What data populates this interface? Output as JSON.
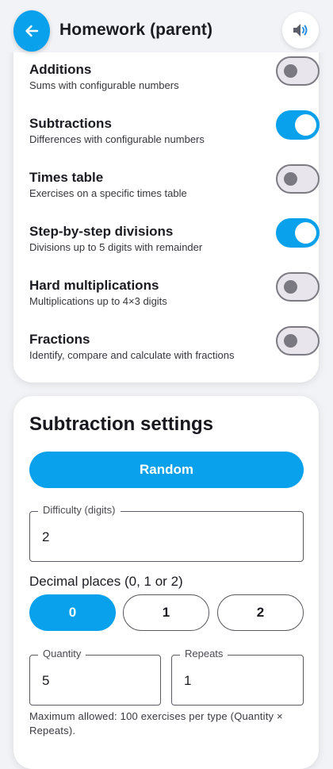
{
  "header": {
    "title": "Homework (parent)",
    "back_icon": "arrow-left-icon",
    "sound_icon": "speaker-icon"
  },
  "exercise_types": [
    {
      "title": "Additions",
      "subtitle": "Sums with configurable numbers",
      "enabled": false
    },
    {
      "title": "Subtractions",
      "subtitle": "Differences with configurable numbers",
      "enabled": true
    },
    {
      "title": "Times table",
      "subtitle": "Exercises on a specific times table",
      "enabled": false
    },
    {
      "title": "Step-by-step divisions",
      "subtitle": "Divisions up to 5 digits with remainder",
      "enabled": true
    },
    {
      "title": "Hard multiplications",
      "subtitle": "Multiplications up to 4×3 digits",
      "enabled": false
    },
    {
      "title": "Fractions",
      "subtitle": "Identify, compare and calculate with fractions",
      "enabled": false
    }
  ],
  "settings": {
    "title": "Subtraction settings",
    "random_label": "Random",
    "difficulty": {
      "label": "Difficulty (digits)",
      "value": "2"
    },
    "decimal_label": "Decimal places (0, 1 or 2)",
    "decimal_options": [
      "0",
      "1",
      "2"
    ],
    "decimal_selected": "0",
    "quantity": {
      "label": "Quantity",
      "value": "5"
    },
    "repeats": {
      "label": "Repeats",
      "value": "1"
    },
    "footnote": "Maximum allowed: 100 exercises per type (Quantity × Repeats)."
  },
  "colors": {
    "accent": "#0aa1ec",
    "background": "#f2f3f7",
    "card": "#ffffff",
    "toggle_off_track": "#e8e5ec",
    "toggle_off_knob": "#7a7880"
  }
}
